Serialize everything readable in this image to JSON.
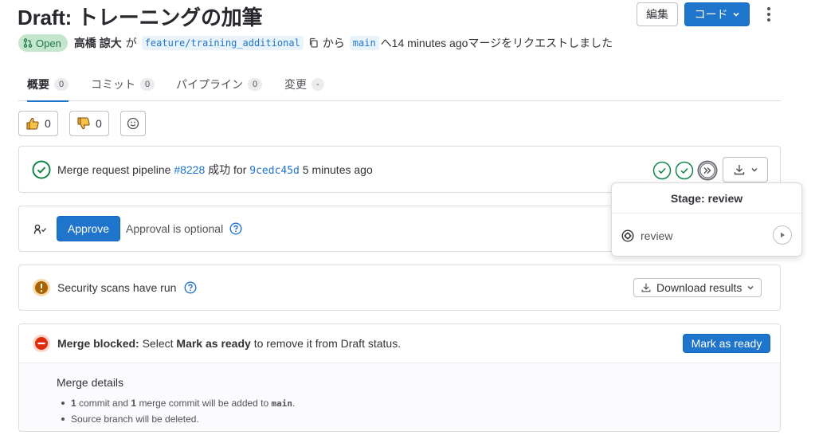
{
  "header": {
    "title": "Draft: トレーニングの加筆",
    "edit_label": "編集",
    "code_label": "コード"
  },
  "meta": {
    "status": "Open",
    "author": "高橋 諒大",
    "ga": "が",
    "source_branch": "feature/training_additional",
    "kara": "から",
    "target_branch": "main",
    "suffix": "へ14 minutes agoマージをリクエストしました"
  },
  "tabs": [
    {
      "label": "概要",
      "count": "0"
    },
    {
      "label": "コミット",
      "count": "0"
    },
    {
      "label": "パイプライン",
      "count": "0"
    },
    {
      "label": "変更",
      "count": "-"
    }
  ],
  "reactions": {
    "thumbsup": "0",
    "thumbsdown": "0"
  },
  "pipeline": {
    "prefix": "Merge request pipeline",
    "id": "#8228",
    "status": "成功",
    "for": "for",
    "sha": "9cedc45d",
    "time": "5 minutes ago"
  },
  "approval": {
    "button": "Approve",
    "text": "Approval is optional"
  },
  "security": {
    "text": "Security scans have run",
    "download_label": "Download results"
  },
  "merge": {
    "blocked_label": "Merge blocked:",
    "msg_select": "Select",
    "msg_mark": "Mark as ready",
    "msg_rest": "to remove it from Draft status.",
    "button": "Mark as ready",
    "details_title": "Merge details",
    "detail1_n1": "1",
    "detail1_a": "commit and",
    "detail1_n2": "1",
    "detail1_b": "merge commit will be added to",
    "detail1_branch": "main",
    "detail1_end": ".",
    "detail2": "Source branch will be deleted."
  },
  "popover": {
    "title": "Stage: review",
    "job": "review"
  },
  "colors": {
    "primary": "#1f75cb",
    "success": "#108548",
    "warning": "#ab6100",
    "danger": "#dd2b0e"
  }
}
